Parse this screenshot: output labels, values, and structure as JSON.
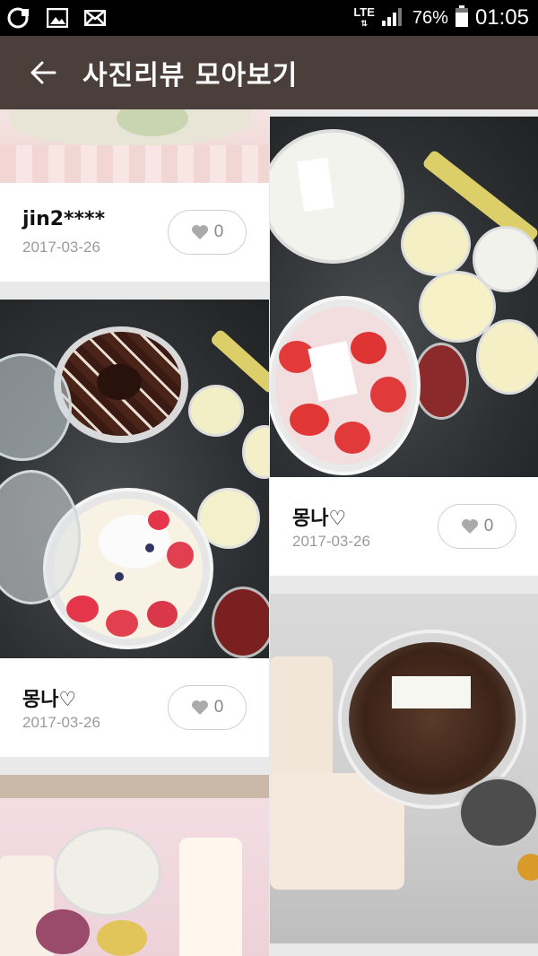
{
  "status_bar": {
    "network": "LTE",
    "battery_percent": "76%",
    "time": "01:05",
    "left_icons": [
      "uplus-icon",
      "gallery-icon",
      "mail-icon"
    ]
  },
  "app_bar": {
    "title": "사진리뷰 모아보기",
    "back_icon": "arrow-left-icon"
  },
  "reviews_left": [
    {
      "author": "jin2****",
      "date": "2017-03-26",
      "likes": "0"
    },
    {
      "author": "몽나♡",
      "date": "2017-03-26",
      "likes": "0"
    }
  ],
  "reviews_right": [
    {
      "author": "몽나♡",
      "date": "2017-03-26",
      "likes": "0"
    }
  ],
  "colors": {
    "app_bar": "#4a3f3b",
    "status_bar": "#000000",
    "background": "#e9e9e9"
  }
}
